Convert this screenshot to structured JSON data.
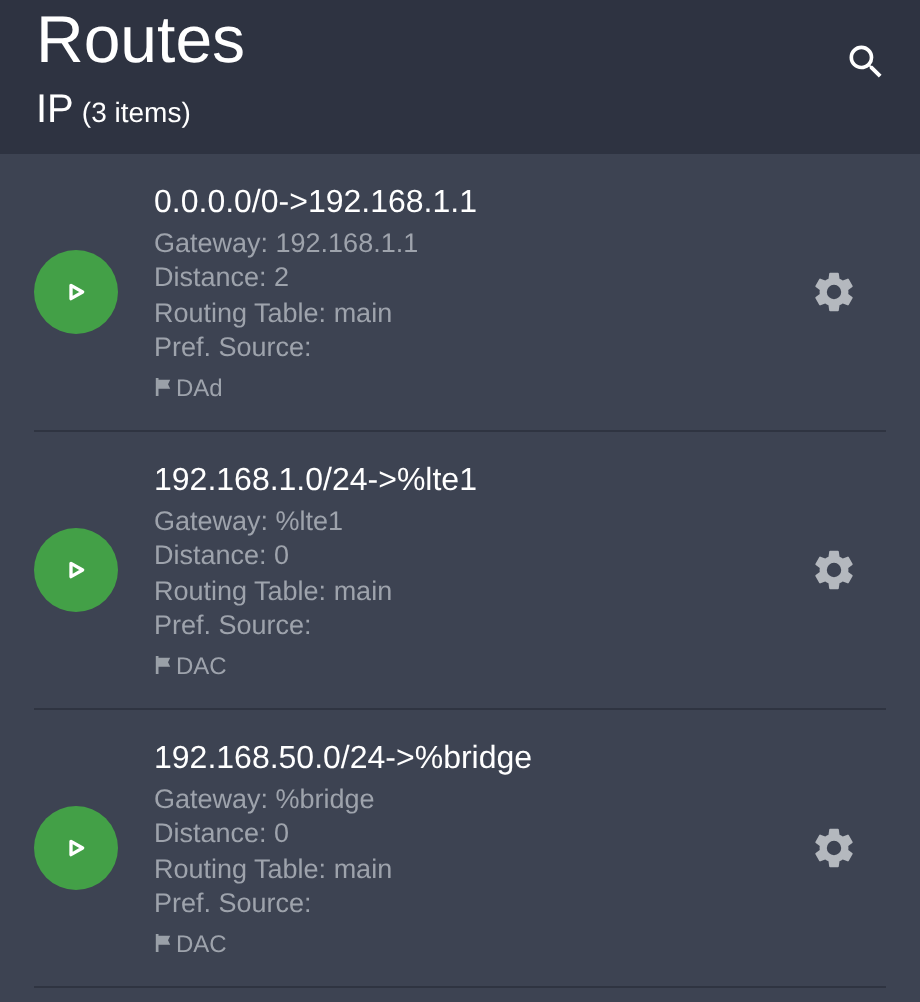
{
  "header": {
    "title": "Routes",
    "subtitle": "IP",
    "count": "(3 items)"
  },
  "routes": [
    {
      "title": "0.0.0.0/0->192.168.1.1",
      "details": [
        "Gateway: 192.168.1.1",
        "Distance: 2",
        "Routing Table: main",
        "Pref. Source:"
      ],
      "flags": "DAd"
    },
    {
      "title": "192.168.1.0/24->%lte1",
      "details": [
        "Gateway: %lte1",
        "Distance: 0",
        "Routing Table: main",
        "Pref. Source:"
      ],
      "flags": "DAC"
    },
    {
      "title": "192.168.50.0/24->%bridge",
      "details": [
        "Gateway: %bridge",
        "Distance: 0",
        "Routing Table: main",
        "Pref. Source:"
      ],
      "flags": "DAC"
    }
  ]
}
